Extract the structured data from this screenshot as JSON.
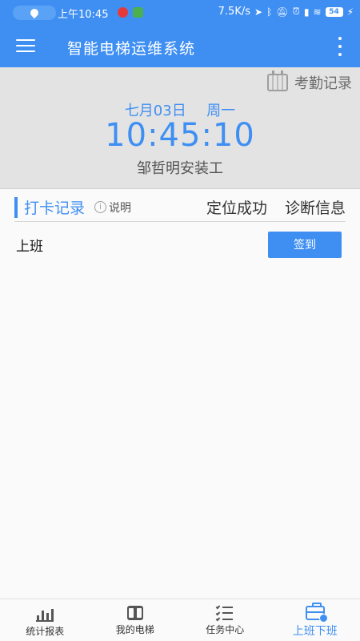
{
  "status_bar": {
    "time": "上午10:45",
    "net_speed": "7.5K/s",
    "battery": "54"
  },
  "app_bar": {
    "title": "智能电梯运维系统"
  },
  "header": {
    "attendance_link": "考勤记录",
    "date": "七月03日",
    "weekday": "周一",
    "time": "10:45:10",
    "worker": "邹哲明安装工"
  },
  "records": {
    "title": "打卡记录",
    "info_label": "说明",
    "location_status": "定位成功",
    "diagnose_label": "诊断信息"
  },
  "shift": {
    "label": "上班",
    "button": "签到"
  },
  "bottom_nav": {
    "items": [
      {
        "label": "统计报表",
        "icon": "bar-chart-icon"
      },
      {
        "label": "我的电梯",
        "icon": "elevator-icon"
      },
      {
        "label": "任务中心",
        "icon": "task-list-icon"
      },
      {
        "label": "上班下班",
        "icon": "briefcase-check-icon"
      }
    ],
    "active_index": 3
  },
  "colors": {
    "primary": "#3f8ff3",
    "header_bg": "#e3e3e3"
  }
}
